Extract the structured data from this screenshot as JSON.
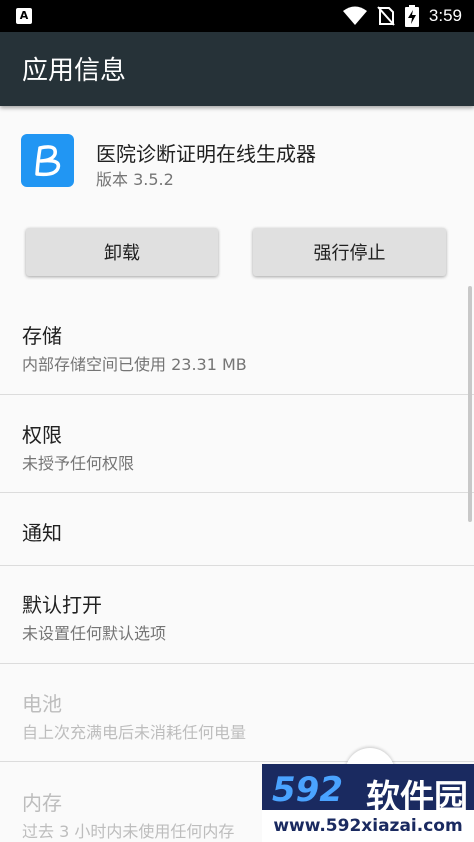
{
  "status_bar": {
    "notification_icon": "A",
    "time": "3:59",
    "icons": [
      "wifi-icon",
      "no-sim-icon",
      "battery-charging-icon"
    ]
  },
  "app_bar": {
    "title": "应用信息"
  },
  "app": {
    "icon_letter": "B",
    "name": "医院诊断证明在线生成器",
    "version": "版本 3.5.2"
  },
  "buttons": {
    "uninstall": "卸载",
    "force_stop": "强行停止"
  },
  "sections": {
    "storage": {
      "title": "存储",
      "subtitle": "内部存储空间已使用 23.31 MB"
    },
    "permissions": {
      "title": "权限",
      "subtitle": "未授予任何权限"
    },
    "notifications": {
      "title": "通知"
    },
    "open_by_default": {
      "title": "默认打开",
      "subtitle": "未设置任何默认选项"
    },
    "battery": {
      "title": "电池",
      "subtitle": "自上次充满电后未消耗任何电量"
    },
    "memory": {
      "title": "内存",
      "subtitle": "过去 3 小时内未使用任何内存"
    }
  },
  "watermark": {
    "brand_number": "592",
    "brand_text": "软件园",
    "url": "www.592xiazai.com"
  },
  "colors": {
    "app_bar": "#263238",
    "accent": "#2196f3",
    "status_bar": "#000000"
  }
}
